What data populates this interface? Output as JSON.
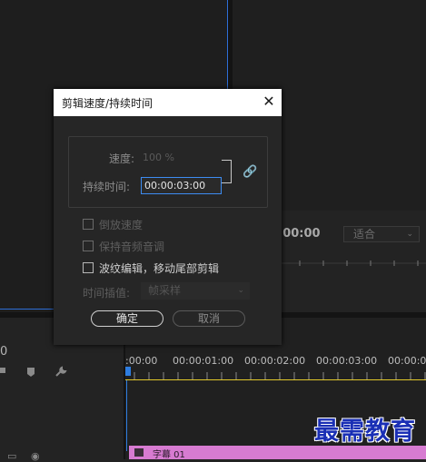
{
  "dialog": {
    "title": "剪辑速度/持续时间",
    "speed_label": "速度:",
    "speed_value": "100 %",
    "duration_label": "持续时间:",
    "duration_value": "00:00:03:00",
    "options": [
      {
        "label": "倒放速度",
        "checked": false,
        "enabled": false
      },
      {
        "label": "保持音频音调",
        "checked": false,
        "enabled": false
      },
      {
        "label": "波纹编辑，移动尾部剪辑",
        "checked": false,
        "enabled": true
      }
    ],
    "interp_label": "时间插值:",
    "interp_value": "帧采样",
    "ok_label": "确定",
    "cancel_label": "取消"
  },
  "program_monitor": {
    "timecode": ":00:00",
    "fit_value": "适合"
  },
  "timeline": {
    "current_time": "0",
    "ruler_labels": [
      ":00:00",
      "00:00:01:00",
      "00:00:02:00",
      "00:00:03:00",
      "00:00:04"
    ],
    "clip_label": "字幕 01"
  },
  "watermark": "最需教育",
  "colors": {
    "accent": "#2e7de0",
    "clip": "#d77bd1",
    "work_area": "#e1c72b"
  }
}
